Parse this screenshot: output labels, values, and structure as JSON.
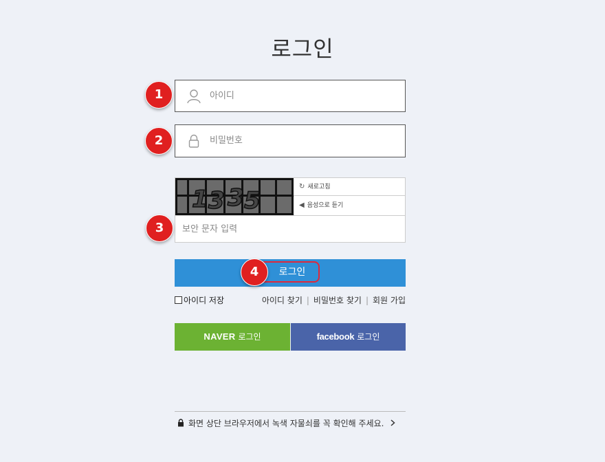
{
  "page": {
    "title": "로그인"
  },
  "form": {
    "id_placeholder": "아이디",
    "pw_placeholder": "비밀번호",
    "captcha": {
      "refresh_label": "새로고침",
      "audio_label": "음성으로 듣기",
      "input_placeholder": "보안 문자 입력"
    },
    "login_label": "로그인"
  },
  "badges": [
    "1",
    "2",
    "3",
    "4"
  ],
  "links": {
    "save_id_label": "아이디 저장",
    "find_id": "아이디 찾기",
    "find_pw": "비밀번호 찾기",
    "signup": "회원 가입",
    "separator": "|"
  },
  "social": {
    "naver_brand": "NAVER",
    "naver_suffix": "로그인",
    "facebook_brand": "facebook",
    "facebook_suffix": "로그인"
  },
  "notice": {
    "text": "화면 상단 브라우저에서 녹색 자물쇠를 꼭 확인해 주세요."
  },
  "colors": {
    "background": "#eef1f7",
    "login_button": "#2f90d7",
    "naver": "#6cb233",
    "facebook": "#4a64a9",
    "badge": "#e02020"
  },
  "icons": [
    "user-icon",
    "lock-icon",
    "refresh-icon",
    "speaker-icon",
    "padlock-icon",
    "chevron-right-icon"
  ]
}
